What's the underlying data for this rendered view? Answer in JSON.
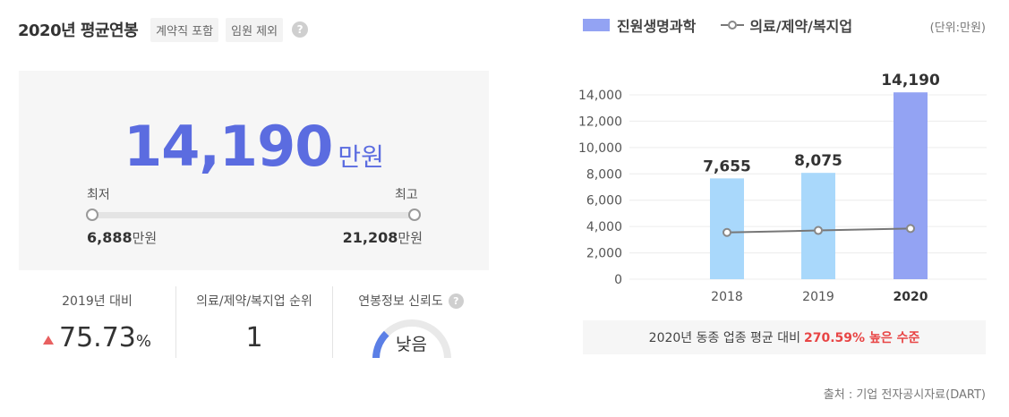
{
  "header": {
    "title": "2020년 평균연봉",
    "tags": [
      "계약직 포함",
      "임원 제외"
    ],
    "help": "?"
  },
  "salary": {
    "value": "14,190",
    "unit": "만원",
    "min_label": "최저",
    "max_label": "최고",
    "min_value": "6,888",
    "max_value": "21,208",
    "value_unit": "만원"
  },
  "stats": {
    "yoy_label": "2019년 대비",
    "yoy_value": "75.73",
    "yoy_pct": "%",
    "rank_label": "의료/제약/복지업 순위",
    "rank_value": "1",
    "reliability_label": "연봉정보 신뢰도",
    "reliability_value": "낮음",
    "reliability_level": 0.25
  },
  "legend": {
    "bar_series": "진원생명과학",
    "line_series": "의료/제약/복지업",
    "unit": "(단위:만원)"
  },
  "colors": {
    "accent": "#5b6ce0",
    "bar_light": "#a9d8fb",
    "bar_highlight": "#93a3f3",
    "line": "#777777",
    "up": "#e86060",
    "highlight_text": "#e84545"
  },
  "chart_data": {
    "type": "bar",
    "categories": [
      "2018",
      "2019",
      "2020"
    ],
    "series": [
      {
        "name": "진원생명과학",
        "values": [
          7655,
          8075,
          14190
        ],
        "labels": [
          "7,655",
          "8,075",
          "14,190"
        ]
      },
      {
        "name": "의료/제약/복지업",
        "values": [
          3550,
          3700,
          3850
        ]
      }
    ],
    "y_ticks": [
      "0",
      "2,000",
      "4,000",
      "6,000",
      "8,000",
      "10,000",
      "12,000",
      "14,000"
    ],
    "ylim": [
      0,
      14000
    ],
    "grid": true,
    "highlight_category": "2020"
  },
  "compare": {
    "prefix": "2020년 동종 업종 평균 대비",
    "highlight": "270.59% 높은 수준"
  },
  "source": "출처 : 기업 전자공시자료(DART)"
}
